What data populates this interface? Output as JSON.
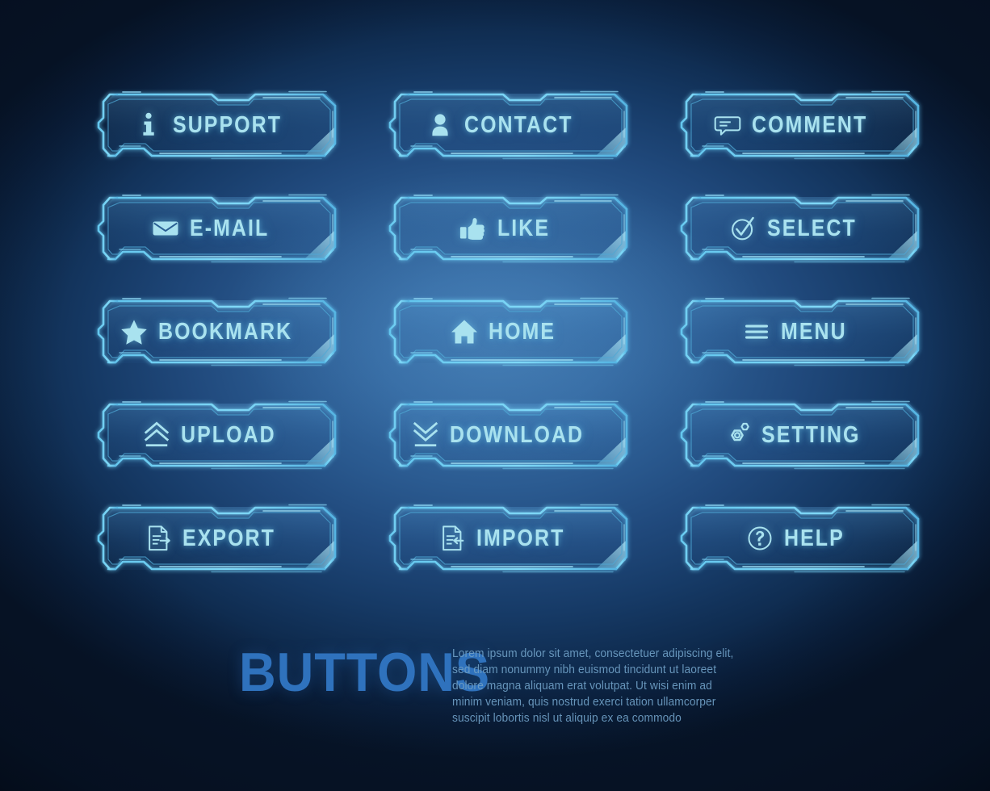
{
  "background": {
    "center_color": "#3d74ab",
    "edge_color": "#071529",
    "accent_color": "#5fd0f5"
  },
  "theme": {
    "frame_stroke": "#62c8ef",
    "frame_stroke_dim": "#4a9fd4",
    "frame_fill": "rgba(40,95,150,0.18)",
    "icon_color": "#a9e2ef",
    "label_color": "#a9e2ef",
    "corner_triangle": "#9fdcf0"
  },
  "buttons": [
    {
      "id": "support",
      "label": "SUPPORT",
      "icon": "info-icon"
    },
    {
      "id": "contact",
      "label": "CONTACT",
      "icon": "user-icon"
    },
    {
      "id": "comment",
      "label": "COMMENT",
      "icon": "speech-bubble-icon"
    },
    {
      "id": "email",
      "label": "E-MAIL",
      "icon": "envelope-icon"
    },
    {
      "id": "like",
      "label": "LIKE",
      "icon": "thumbs-up-icon"
    },
    {
      "id": "select",
      "label": "SELECT",
      "icon": "check-circle-icon"
    },
    {
      "id": "bookmark",
      "label": "BOOKMARK",
      "icon": "star-icon"
    },
    {
      "id": "home",
      "label": "HOME",
      "icon": "house-icon"
    },
    {
      "id": "menu",
      "label": "MENU",
      "icon": "hamburger-icon"
    },
    {
      "id": "upload",
      "label": "UPLOAD",
      "icon": "double-chevron-up-icon"
    },
    {
      "id": "download",
      "label": "DOWNLOAD",
      "icon": "double-chevron-down-icon"
    },
    {
      "id": "setting",
      "label": "SETTING",
      "icon": "gear-icon"
    },
    {
      "id": "export",
      "label": "EXPORT",
      "icon": "document-arrow-right-icon"
    },
    {
      "id": "import",
      "label": "IMPORT",
      "icon": "document-arrow-left-icon"
    },
    {
      "id": "help",
      "label": "HELP",
      "icon": "question-circle-icon"
    }
  ],
  "footer": {
    "title": "BUTTONS",
    "body": "Lorem ipsum dolor sit amet, consectetuer adipiscing elit, sed diam nonummy nibh euismod tincidunt ut laoreet dolore magna aliquam erat volutpat. Ut wisi enim ad minim veniam, quis nostrud exerci tation ullamcorper suscipit lobortis nisl ut aliquip ex ea commodo"
  }
}
